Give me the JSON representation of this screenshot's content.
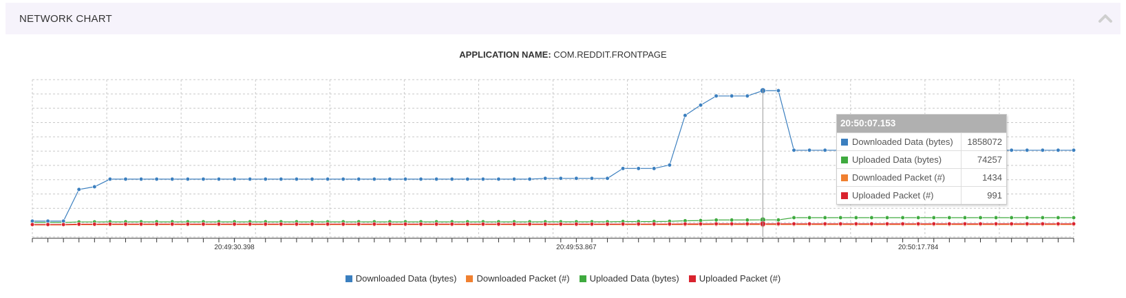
{
  "panel": {
    "title": "NETWORK CHART"
  },
  "app": {
    "label": "APPLICATION NAME:",
    "value": "COM.REDDIT.FRONTPAGE"
  },
  "chart_data": {
    "type": "line",
    "x_tick_labels": [
      "20:49:30.398",
      "20:49:53.867",
      "20:50:17.784"
    ],
    "x_tick_label_indices": [
      13,
      35,
      57
    ],
    "highlighted_index": 47,
    "series": [
      {
        "name": "Downloaded Data (bytes)",
        "color": "#3b7fbf",
        "values": [
          0,
          0,
          0,
          830000,
          900000,
          1100000,
          1100000,
          1100000,
          1100000,
          1100000,
          1100000,
          1100000,
          1100000,
          1100000,
          1100000,
          1100000,
          1100000,
          1100000,
          1100000,
          1100000,
          1100000,
          1100000,
          1100000,
          1100000,
          1100000,
          1100000,
          1100000,
          1100000,
          1100000,
          1100000,
          1100000,
          1100000,
          1100000,
          1120000,
          1120000,
          1120000,
          1120000,
          1120000,
          1380000,
          1380000,
          1380000,
          1470000,
          2770000,
          3040000,
          3280000,
          3280000,
          3280000,
          3420000,
          3420000,
          1858072,
          1858072,
          1858072,
          1858072,
          1858072,
          1858072,
          1858072,
          1858072,
          1858072,
          1858072,
          1858072,
          1858072,
          1858072,
          1858072,
          1858072,
          1858072,
          1858072,
          1858072,
          1858072
        ]
      },
      {
        "name": "Uploaded Data (bytes)",
        "color": "#3faa3f",
        "values": [
          0,
          0,
          0,
          8000,
          9000,
          10000,
          10000,
          10000,
          10000,
          10000,
          10000,
          10000,
          10000,
          10000,
          10000,
          10000,
          10000,
          10000,
          10000,
          10000,
          10000,
          10000,
          10000,
          10000,
          10000,
          10000,
          10000,
          10000,
          10000,
          10000,
          10000,
          10000,
          10000,
          11000,
          11000,
          11000,
          11000,
          11000,
          15000,
          15000,
          15000,
          18000,
          26000,
          30000,
          38000,
          38000,
          38000,
          40000,
          40000,
          74257,
          74257,
          74257,
          74257,
          74257,
          74257,
          74257,
          74257,
          74257,
          74257,
          74257,
          74257,
          74257,
          74257,
          74257,
          74257,
          74257,
          74257,
          74257
        ]
      },
      {
        "name": "Downloaded Packet (#)",
        "color": "#f08030",
        "values": [
          0,
          0,
          0,
          700,
          750,
          900,
          900,
          900,
          900,
          900,
          900,
          900,
          900,
          900,
          900,
          900,
          900,
          900,
          900,
          900,
          900,
          900,
          900,
          900,
          900,
          900,
          900,
          900,
          900,
          900,
          900,
          900,
          900,
          910,
          910,
          910,
          910,
          910,
          1050,
          1050,
          1050,
          1100,
          1250,
          1300,
          1380,
          1380,
          1380,
          1420,
          1420,
          1434,
          1434,
          1434,
          1434,
          1434,
          1434,
          1434,
          1434,
          1434,
          1434,
          1434,
          1434,
          1434,
          1434,
          1434,
          1434,
          1434,
          1434,
          1434
        ]
      },
      {
        "name": "Uploaded Packet (#)",
        "color": "#d9232e",
        "values": [
          0,
          0,
          0,
          500,
          520,
          600,
          600,
          600,
          600,
          600,
          600,
          600,
          600,
          600,
          600,
          600,
          600,
          600,
          600,
          600,
          600,
          600,
          600,
          600,
          600,
          600,
          600,
          600,
          600,
          600,
          600,
          600,
          600,
          610,
          610,
          610,
          610,
          610,
          700,
          700,
          700,
          740,
          850,
          900,
          950,
          950,
          950,
          980,
          980,
          991,
          991,
          991,
          991,
          991,
          991,
          991,
          991,
          991,
          991,
          991,
          991,
          991,
          991,
          991,
          991,
          991,
          991,
          991
        ]
      }
    ],
    "legend_order": [
      "Downloaded Data (bytes)",
      "Downloaded Packet (#)",
      "Uploaded Data (bytes)",
      "Uploaded Packet (#)"
    ],
    "legend_position": "bottom",
    "grid": true
  },
  "tooltip": {
    "time": "20:50:07.153",
    "rows": [
      {
        "name": "Downloaded Data (bytes)",
        "value": "1858072",
        "color": "#3b7fbf"
      },
      {
        "name": "Uploaded Data (bytes)",
        "value": "74257",
        "color": "#3faa3f"
      },
      {
        "name": "Downloaded Packet (#)",
        "value": "1434",
        "color": "#f08030"
      },
      {
        "name": "Uploaded Packet (#)",
        "value": "991",
        "color": "#d9232e"
      }
    ]
  },
  "legend": [
    {
      "label": "Downloaded Data (bytes)",
      "color": "#3b7fbf"
    },
    {
      "label": "Downloaded Packet (#)",
      "color": "#f08030"
    },
    {
      "label": "Uploaded Data (bytes)",
      "color": "#3faa3f"
    },
    {
      "label": "Uploaded Packet (#)",
      "color": "#d9232e"
    }
  ]
}
